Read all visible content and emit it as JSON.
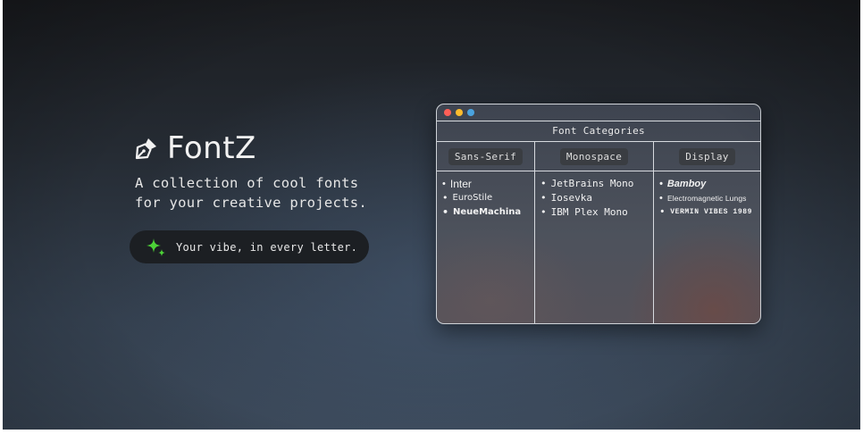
{
  "brand": {
    "title": "FontZ",
    "icon": "pen-nib-icon"
  },
  "tagline": {
    "line1": "A collection of cool fonts",
    "line2": "for your creative projects."
  },
  "pill": {
    "text": "Your vibe, in every letter.",
    "icon": "sparkle-icon",
    "icon_color": "#4cd137"
  },
  "window": {
    "title": "Font Categories",
    "traffic_lights": [
      "#ff5f57",
      "#febc2e",
      "#4aa3df"
    ],
    "columns": [
      {
        "header": "Sans-Serif",
        "items": [
          "Inter",
          "EuroStile",
          "NeueMachina"
        ]
      },
      {
        "header": "Monospace",
        "items": [
          "JetBrains Mono",
          "Iosevka",
          "IBM Plex Mono"
        ]
      },
      {
        "header": "Display",
        "items": [
          "Bamboy",
          "Electromagnetic Lungs",
          "VERMIN VIBES 1989"
        ]
      }
    ]
  }
}
